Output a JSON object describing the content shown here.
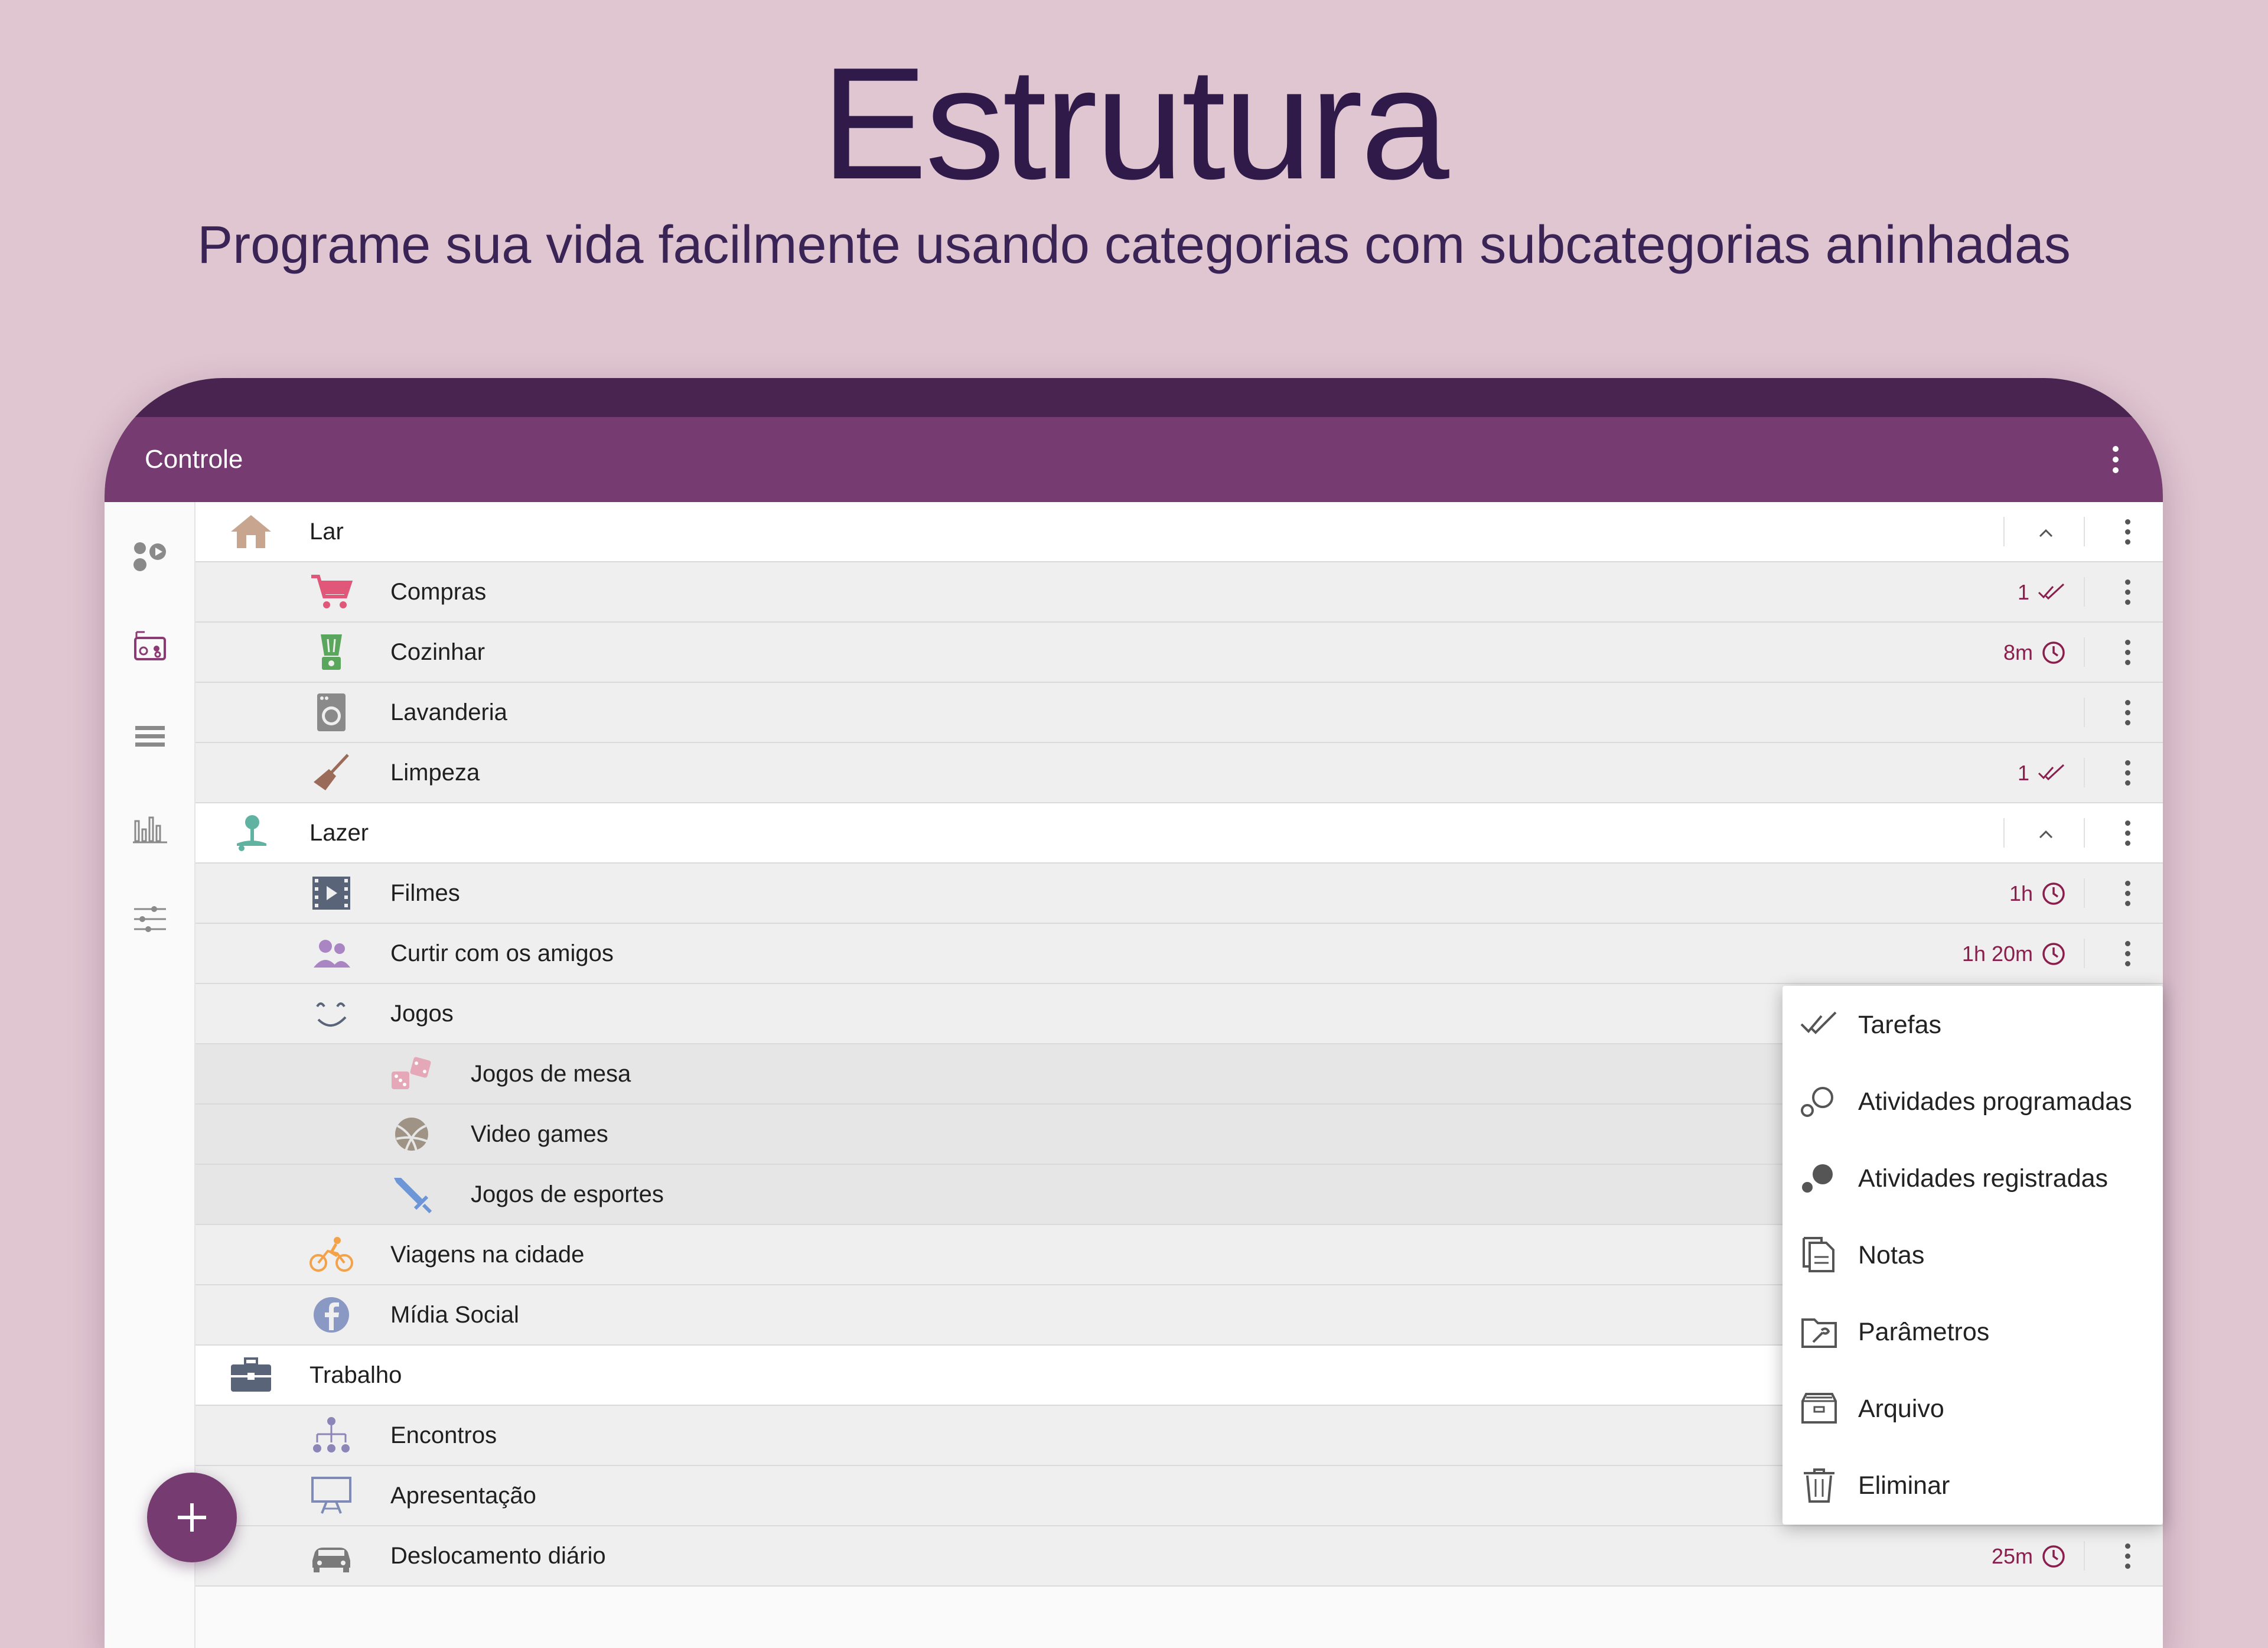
{
  "headline": "Estrutura",
  "subline": "Programe sua vida facilmente usando categorias com subcategorias aninhadas",
  "appbar": {
    "title": "Controle",
    "menu_icon": "more-vert-icon"
  },
  "rail": {
    "items": [
      {
        "name": "activities-icon"
      },
      {
        "name": "radio-icon"
      },
      {
        "name": "list-icon"
      },
      {
        "name": "stats-icon"
      },
      {
        "name": "sliders-icon"
      }
    ]
  },
  "rows": [
    {
      "label": "Lar",
      "level": 1,
      "icon": "house-icon",
      "expanded": true
    },
    {
      "label": "Compras",
      "level": 2,
      "icon": "cart-icon",
      "meta_value": "1",
      "meta_icon": "double-check-icon"
    },
    {
      "label": "Cozinhar",
      "level": 2,
      "icon": "blender-icon",
      "meta_value": "8m",
      "meta_icon": "clock-icon"
    },
    {
      "label": "Lavanderia",
      "level": 2,
      "icon": "washer-icon"
    },
    {
      "label": "Limpeza",
      "level": 2,
      "icon": "broom-icon",
      "meta_value": "1",
      "meta_icon": "double-check-icon"
    },
    {
      "label": "Lazer",
      "level": 1,
      "icon": "tree-icon",
      "expanded": true
    },
    {
      "label": "Filmes",
      "level": 2,
      "icon": "film-icon",
      "meta_value": "1h",
      "meta_icon": "clock-icon"
    },
    {
      "label": "Curtir com os amigos",
      "level": 2,
      "icon": "people-icon",
      "meta_value": "1h 20m",
      "meta_icon": "clock-icon"
    },
    {
      "label": "Jogos",
      "level": 2,
      "icon": "smile-icon"
    },
    {
      "label": "Jogos de mesa",
      "level": 3,
      "icon": "dice-icon"
    },
    {
      "label": "Video games",
      "level": 3,
      "icon": "ball-icon"
    },
    {
      "label": "Jogos de esportes",
      "level": 3,
      "icon": "sword-icon"
    },
    {
      "label": "Viagens na cidade",
      "level": 2,
      "icon": "bike-icon"
    },
    {
      "label": "Mídia Social",
      "level": 2,
      "icon": "facebook-icon"
    },
    {
      "label": "Trabalho",
      "level": 1,
      "icon": "briefcase-icon"
    },
    {
      "label": "Encontros",
      "level": 2,
      "icon": "org-chart-icon"
    },
    {
      "label": "Apresentação",
      "level": 2,
      "icon": "easel-icon"
    },
    {
      "label": "Deslocamento diário",
      "level": 2,
      "icon": "car-icon",
      "meta_value": "25m",
      "meta_icon": "clock-icon"
    }
  ],
  "popup_menu": [
    {
      "label": "Tarefas",
      "icon": "double-check-icon"
    },
    {
      "label": "Atividades programadas",
      "icon": "outline-circles-icon"
    },
    {
      "label": "Atividades registradas",
      "icon": "filled-circles-icon"
    },
    {
      "label": "Notas",
      "icon": "notes-icon"
    },
    {
      "label": "Parâmetros",
      "icon": "wrench-folder-icon"
    },
    {
      "label": "Arquivo",
      "icon": "archive-icon"
    },
    {
      "label": "Eliminar",
      "icon": "trash-icon"
    }
  ],
  "fab": {
    "icon": "plus-icon"
  },
  "colors": {
    "background": "#e0c6d1",
    "headline": "#2f1a4a",
    "appbar": "#763b70",
    "statusbar": "#4a2450",
    "meta": "#8a1e4d"
  }
}
